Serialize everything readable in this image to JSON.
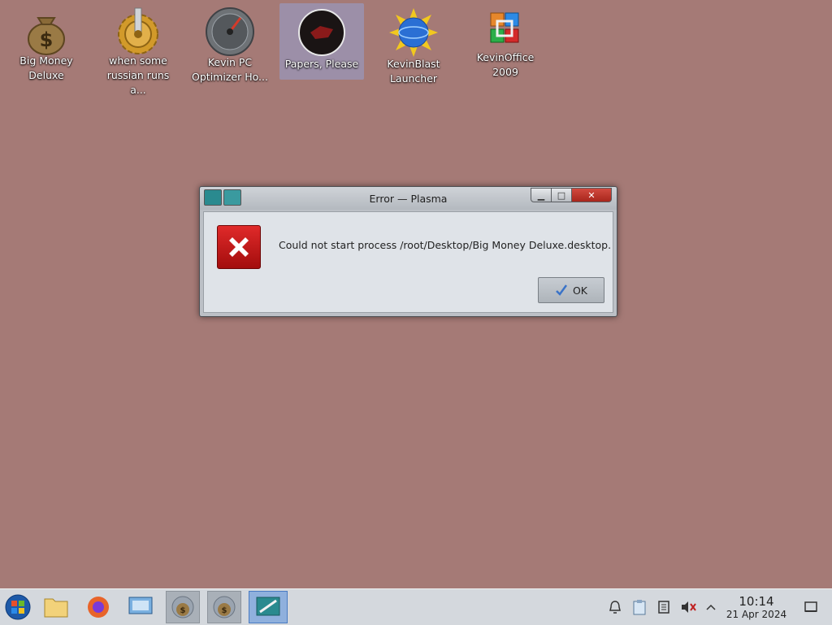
{
  "desktop": {
    "icons": [
      {
        "label_line1": "Big Money",
        "label_line2": "Deluxe",
        "icon": "money-bag-icon"
      },
      {
        "label_line1": "when some",
        "label_line2": "russian runs a...",
        "icon": "gear-icon"
      },
      {
        "label_line1": "Kevin PC",
        "label_line2": "Optimizer Ho...",
        "icon": "speedometer-icon"
      },
      {
        "label_line1": "Papers, Please",
        "label_line2": "",
        "icon": "papers-please-icon",
        "selected": true
      },
      {
        "label_line1": "KevinBlast",
        "label_line2": "Launcher",
        "icon": "globe-sun-icon"
      },
      {
        "label_line1": "KevinOffice",
        "label_line2": "2009",
        "icon": "office-icon"
      }
    ]
  },
  "dialog": {
    "title": "Error — Plasma",
    "message": "Could not start process /root/Desktop/Big Money Deluxe.desktop.",
    "ok_label": "OK",
    "minimize_symbol": "▁",
    "maximize_symbol": "□",
    "close_symbol": "✕"
  },
  "taskbar": {
    "clock_time": "10:14",
    "clock_date": "21 Apr 2024",
    "apps": [
      "start-orb-icon",
      "file-manager-icon",
      "firefox-icon",
      "system-settings-icon",
      "money-bag-icon",
      "money-bag-icon",
      "plasma-error-icon"
    ]
  },
  "colors": {
    "desktop_bg": "#a57a76",
    "dialog_bg": "#dfe3e8",
    "error_red": "#d32020",
    "selection": "#9c8fa8"
  }
}
